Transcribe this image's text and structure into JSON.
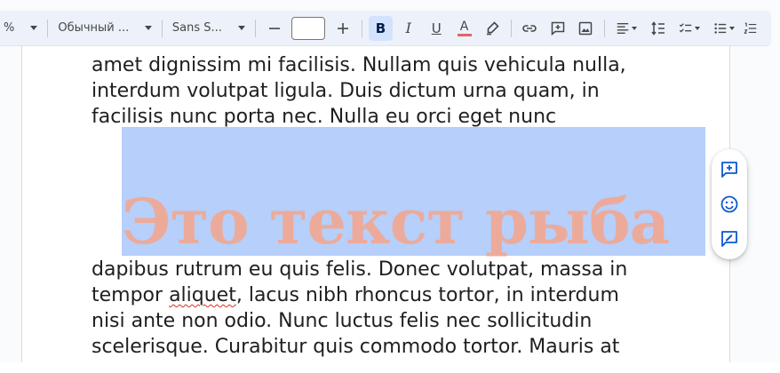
{
  "toolbar": {
    "zoom_fragment": "%",
    "paragraph_style": "Обычный ...",
    "font_family": "Sans S...",
    "font_size": "",
    "bold_label": "B",
    "italic_label": "I",
    "underline_label": "U",
    "text_color_label": "A",
    "colors": {
      "accent_active_bg": "#d3e3fd",
      "text_color_bar": "#e06666"
    }
  },
  "document": {
    "top_lines": [
      "amet dignissim mi facilisis. Nullam quis vehicula nulla,",
      "interdum volutpat ligula. Duis dictum urna quam, in",
      "facilisis nunc porta nec. Nulla eu orci eget nunc"
    ],
    "wordart_text": "Это текст рыба",
    "bottom_lines": {
      "l1": "dapibus rutrum eu quis felis. Donec volutpat, massa in",
      "l2_pre": "tempor ",
      "l2_misspelled": "aliquet",
      "l2_post": ", lacus nibh rhoncus tortor, in interdum",
      "l3": "nisi ante non odio. Nunc luctus felis nec sollicitudin",
      "l4": "scelerisque. Curabitur quis commodo tortor. Mauris at"
    }
  },
  "side_panel": {
    "icons": [
      "add-comment-icon",
      "emoji-icon",
      "suggest-edit-icon"
    ]
  }
}
